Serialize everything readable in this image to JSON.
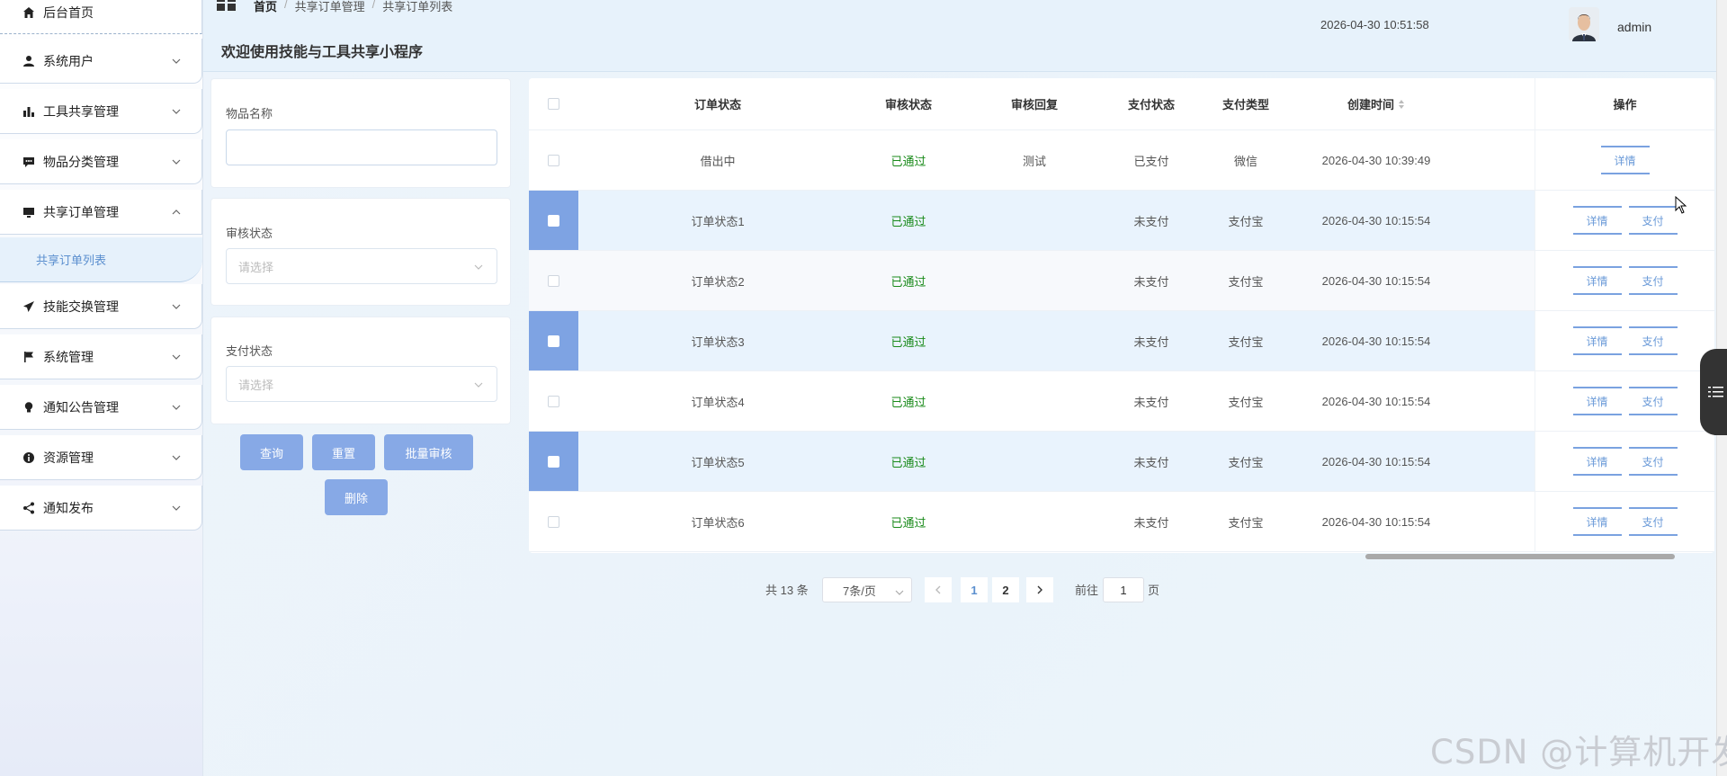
{
  "sidebar": {
    "home": "后台首页",
    "items": [
      {
        "label": "系统用户",
        "expanded": false
      },
      {
        "label": "工具共享管理",
        "expanded": false
      },
      {
        "label": "物品分类管理",
        "expanded": false
      },
      {
        "label": "共享订单管理",
        "expanded": true
      },
      {
        "label": "技能交换管理",
        "expanded": false
      },
      {
        "label": "系统管理",
        "expanded": false
      },
      {
        "label": "通知公告管理",
        "expanded": false
      },
      {
        "label": "资源管理",
        "expanded": false
      },
      {
        "label": "通知发布",
        "expanded": false
      }
    ],
    "active_sub": "共享订单列表"
  },
  "header": {
    "breadcrumb": [
      "首页",
      "共享订单管理",
      "共享订单列表"
    ],
    "site_title": "欢迎使用技能与工具共享小程序",
    "datetime": "2026-04-30 10:51:58",
    "username": "admin"
  },
  "filters": {
    "item_name_label": "物品名称",
    "item_name_value": "",
    "review_status_label": "审核状态",
    "review_status_placeholder": "请选择",
    "pay_status_label": "支付状态",
    "pay_status_placeholder": "请选择",
    "buttons": {
      "search": "查询",
      "reset": "重置",
      "batch_review": "批量审核",
      "delete": "删除"
    }
  },
  "table": {
    "columns": [
      "订单状态",
      "审核状态",
      "审核回复",
      "支付状态",
      "支付类型",
      "创建时间",
      "操作"
    ],
    "rows": [
      {
        "order_status": "借出中",
        "review_status": "已通过",
        "review_reply": "测试",
        "pay_status": "已支付",
        "pay_type": "微信",
        "created": "2026-04-30 10:39:49",
        "selected": false,
        "actions": [
          "详情"
        ]
      },
      {
        "order_status": "订单状态1",
        "review_status": "已通过",
        "review_reply": "",
        "pay_status": "未支付",
        "pay_type": "支付宝",
        "created": "2026-04-30 10:15:54",
        "selected": true,
        "actions": [
          "详情",
          "支付"
        ]
      },
      {
        "order_status": "订单状态2",
        "review_status": "已通过",
        "review_reply": "",
        "pay_status": "未支付",
        "pay_type": "支付宝",
        "created": "2026-04-30 10:15:54",
        "selected": false,
        "actions": [
          "详情",
          "支付"
        ]
      },
      {
        "order_status": "订单状态3",
        "review_status": "已通过",
        "review_reply": "",
        "pay_status": "未支付",
        "pay_type": "支付宝",
        "created": "2026-04-30 10:15:54",
        "selected": true,
        "actions": [
          "详情",
          "支付"
        ]
      },
      {
        "order_status": "订单状态4",
        "review_status": "已通过",
        "review_reply": "",
        "pay_status": "未支付",
        "pay_type": "支付宝",
        "created": "2026-04-30 10:15:54",
        "selected": false,
        "actions": [
          "详情",
          "支付"
        ]
      },
      {
        "order_status": "订单状态5",
        "review_status": "已通过",
        "review_reply": "",
        "pay_status": "未支付",
        "pay_type": "支付宝",
        "created": "2026-04-30 10:15:54",
        "selected": true,
        "actions": [
          "详情",
          "支付"
        ]
      },
      {
        "order_status": "订单状态6",
        "review_status": "已通过",
        "review_reply": "",
        "pay_status": "未支付",
        "pay_type": "支付宝",
        "created": "2026-04-30 10:15:54",
        "selected": false,
        "actions": [
          "详情",
          "支付"
        ]
      }
    ]
  },
  "pagination": {
    "total_text": "共 13 条",
    "page_size": "7条/页",
    "pages": [
      "1",
      "2"
    ],
    "current_page": "1",
    "goto_label": "前往",
    "goto_value": "1",
    "page_suffix": "页"
  },
  "watermark": "CSDN @计算机开发",
  "colors": {
    "accent": "#87a9e6",
    "passed": "#198a1a",
    "selected_row": "#e9f3fd",
    "link": "#5b8fcf"
  }
}
